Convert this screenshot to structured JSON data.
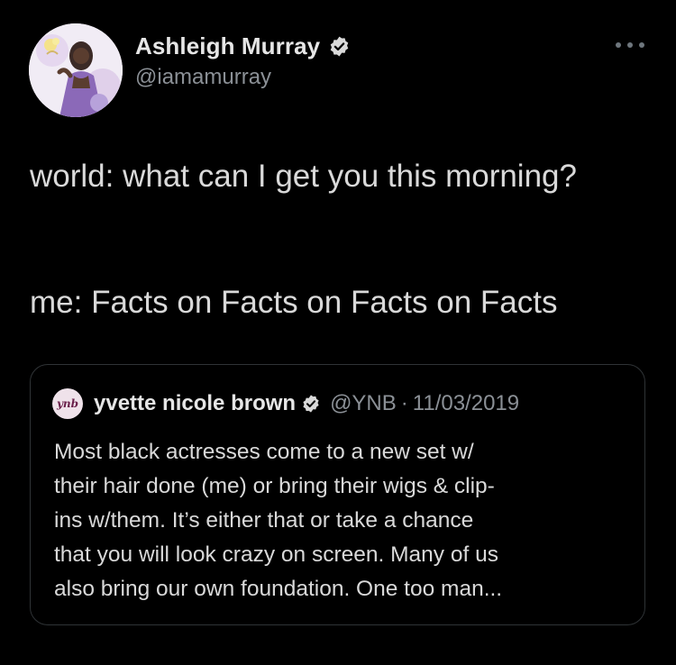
{
  "author": {
    "name": "Ashleigh Murray",
    "handle": "@iamamurray",
    "verified": true
  },
  "tweet": {
    "line1": "world: what can I get you this morning?",
    "line2": "me: Facts on Facts on Facts on Facts"
  },
  "quoted": {
    "avatar_text": "ynb",
    "name": "yvette nicole brown",
    "verified": true,
    "handle": "@YNB",
    "separator": "·",
    "date": "11/03/2019",
    "body_lines": [
      "Most black actresses come to a new set w/",
      "their hair done (me) or bring their wigs & clip-",
      "ins w/them. It’s either that or take a chance",
      "that you will look crazy on screen. Many of us",
      "also bring our own foundation. One too man..."
    ]
  },
  "colors": {
    "background": "#000000",
    "text": "#d9d9d9",
    "muted": "#8b9096",
    "border": "#2f3336",
    "verified_badge": "#d9d9d9"
  },
  "icons": {
    "verified": "verified-badge-icon",
    "more": "more-options-icon"
  }
}
